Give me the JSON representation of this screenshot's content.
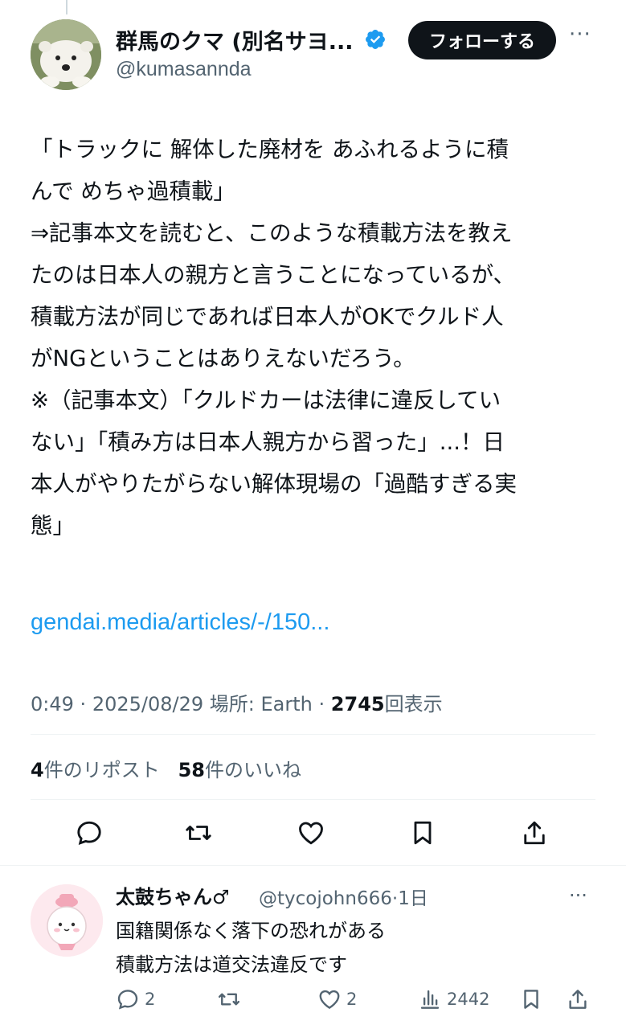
{
  "tweet": {
    "author": {
      "name": "群馬のクマ (別名サヨ...",
      "handle": "@kumasannda",
      "verified": true
    },
    "follow_label": "フォローする",
    "more_label": "···",
    "text": [
      "「トラックに 解体した廃材を あふれるように積",
      "んで めちゃ過積載」",
      "",
      "⇒記事本文を読むと、このような積載方法を教え",
      "たのは日本人の親方と言うことになっているが、",
      "積載方法が同じであれば日本人がOKでクルド人",
      "がNGということはありえないだろう。",
      "",
      "※（記事本文）「クルドカーは法律に違反してい",
      "ない」「積み方は日本人親方から習った」...！日",
      "本人がやりたがらない解体現場の「過酷すぎる実",
      "態」"
    ],
    "link": "gendai.media/articles/-/150...",
    "meta": {
      "time": "0:49",
      "date": "2025/08/29",
      "location_label": "場所: Earth",
      "views": "2745",
      "views_label": "回表示",
      "sep": "·"
    },
    "stats": {
      "reposts": "4",
      "reposts_label": "件のリポスト",
      "likes": "58",
      "likes_label": "件のいいね"
    }
  },
  "reply": {
    "name": "太鼓ちゃん♂",
    "handle": "@tycojohn666",
    "time": "1日",
    "text_line1": "国籍関係なく落下の恐れがある",
    "text_line2": "積載方法は道交法違反です",
    "reply_count": "2",
    "like_count": "2",
    "view_count": "2442",
    "more_label": "···"
  },
  "colors": {
    "accent": "#1d9bf0",
    "text": "#0f1419",
    "secondary": "#536471"
  }
}
